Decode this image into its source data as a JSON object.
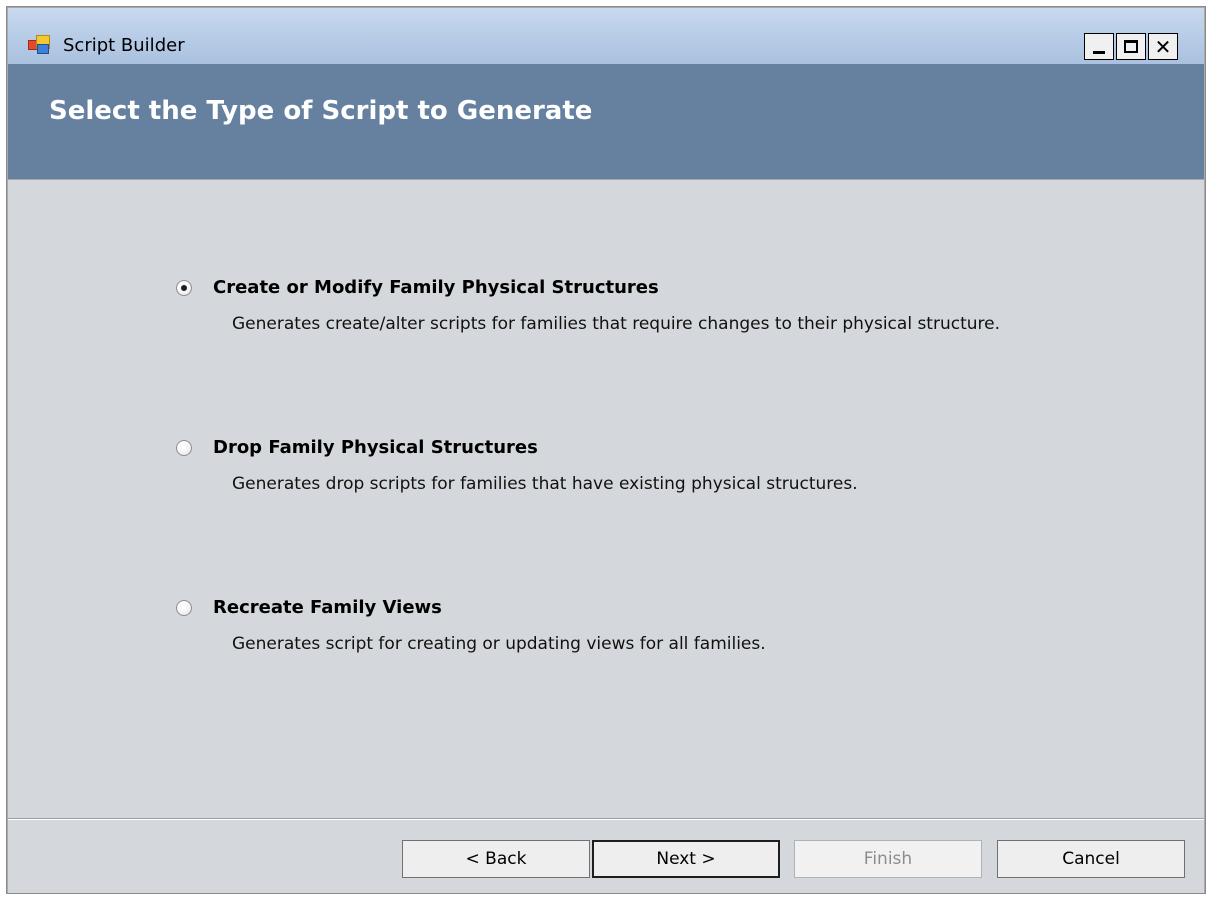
{
  "window": {
    "title": "Script Builder",
    "icon": "app-icon",
    "controls": {
      "minimize": "minimize-icon",
      "maximize": "maximize-icon",
      "close": "close-icon"
    }
  },
  "header": {
    "title": "Select the Type of Script to Generate"
  },
  "options": [
    {
      "label": "Create or Modify Family Physical Structures",
      "description": "Generates create/alter scripts for families that require changes to their physical structure.",
      "checked": true
    },
    {
      "label": "Drop Family Physical Structures",
      "description": "Generates drop scripts for families that have existing physical structures.",
      "checked": false
    },
    {
      "label": "Recreate Family Views",
      "description": "Generates script for creating or updating views for all families.",
      "checked": false
    }
  ],
  "buttons": {
    "back": "< Back",
    "next": "Next >",
    "finish": "Finish",
    "cancel": "Cancel"
  },
  "colors": {
    "header_band": "#6680a0",
    "content_bg": "#d4d7db",
    "titlebar": "#b6cbe6"
  }
}
